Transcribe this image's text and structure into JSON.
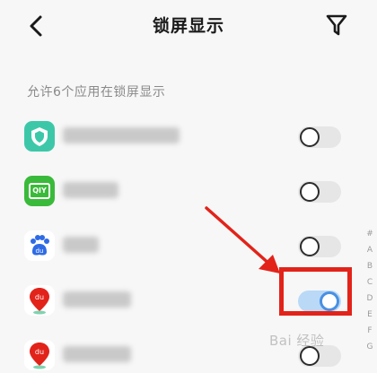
{
  "header": {
    "title": "锁屏显示",
    "back_icon": "chevron-left-icon",
    "filter_icon": "filter-icon"
  },
  "section": {
    "label": "允许6个应用在锁屏显示"
  },
  "apps": [
    {
      "icon": "shield-app-icon",
      "icon_color": "#3cc8a8",
      "name_width": 130,
      "enabled": false
    },
    {
      "icon": "iqiyi-app-icon",
      "icon_color": "#3aba3a",
      "icon_text": "QIY",
      "name_width": 62,
      "enabled": false
    },
    {
      "icon": "baidu-app-icon",
      "icon_color": "#2e6be6",
      "icon_text": "du",
      "name_width": 40,
      "enabled": false
    },
    {
      "icon": "baidu-map-app-icon",
      "icon_color": "#e2231a",
      "icon_text": "du",
      "name_width": 76,
      "enabled": true
    },
    {
      "icon": "baidu-map-app-icon",
      "icon_color": "#e2231a",
      "icon_text": "du",
      "name_width": 76,
      "enabled": false
    }
  ],
  "index_letters": [
    "#",
    "A",
    "B",
    "C",
    "D",
    "E",
    "F",
    "G"
  ],
  "watermark": "Bai 经验",
  "colors": {
    "toggle_on": "#4a90e2",
    "highlight": "#e2231a"
  }
}
